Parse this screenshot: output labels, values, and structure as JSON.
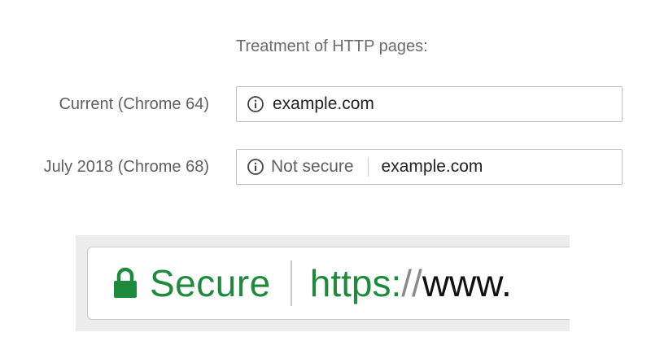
{
  "heading": "Treatment of HTTP pages:",
  "rows": [
    {
      "label": "Current (Chrome 64)",
      "icon": "info-icon",
      "url": "example.com"
    },
    {
      "label": "July 2018 (Chrome 68)",
      "icon": "info-icon",
      "status": "Not secure",
      "url": "example.com"
    }
  ],
  "secure_bar": {
    "icon": "lock-icon",
    "status": "Secure",
    "scheme": "https:",
    "slashes": "//",
    "host": "www.",
    "colors": {
      "secure_green": "#1e8a3c",
      "text": "#111111"
    }
  }
}
